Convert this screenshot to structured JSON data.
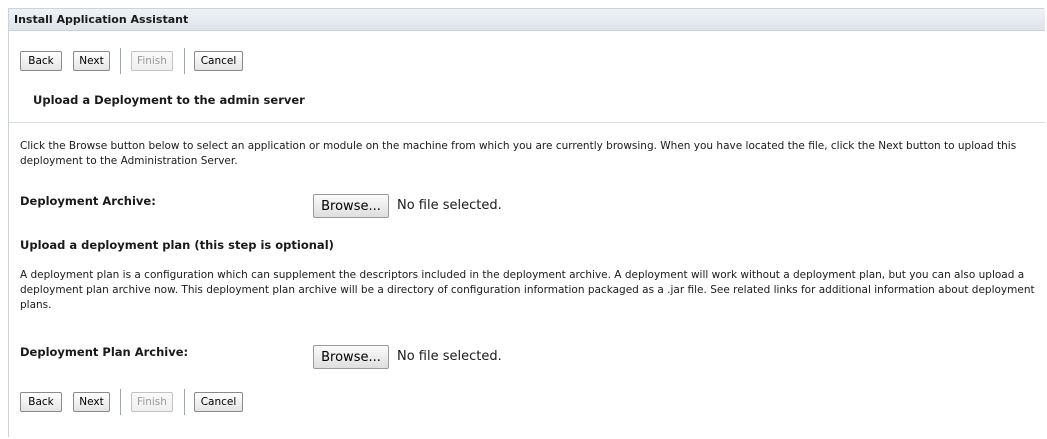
{
  "window": {
    "title": "Install Application Assistant"
  },
  "toolbar": {
    "back_label": "Back",
    "next_label": "Next",
    "finish_label": "Finish",
    "cancel_label": "Cancel"
  },
  "upload_section": {
    "heading": "Upload a Deployment to the admin server",
    "description": "Click the Browse button below to select an application or module on the machine from which you are currently browsing. When you have located the file, click the Next button to upload this deployment to the Administration Server.",
    "field_label": "Deployment Archive:",
    "browse_label": "Browse...",
    "file_status": "No file selected."
  },
  "plan_section": {
    "heading": "Upload a deployment plan (this step is optional)",
    "description": "A deployment plan is a configuration which can supplement the descriptors included in the deployment archive. A deployment will work without a deployment plan, but you can also upload a deployment plan archive now. This deployment plan archive will be a directory of configuration information packaged as a .jar file. See related links for additional information about deployment plans.",
    "field_label": "Deployment Plan Archive:",
    "browse_label": "Browse...",
    "file_status": "No file selected."
  },
  "colors": {
    "titlebar_bg": "#dde4ea",
    "border": "#c9d3dc",
    "disabled_text": "#9a9a9a"
  }
}
